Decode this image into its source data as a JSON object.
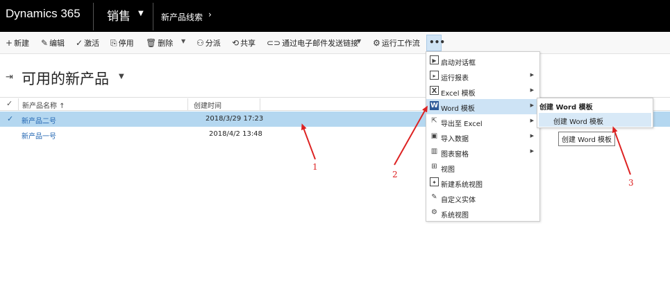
{
  "topnav": {
    "brand": "Dynamics 365",
    "area": "销售",
    "breadcrumb": "新产品线索"
  },
  "commands": [
    {
      "label": "新建",
      "icon": "plus-icon"
    },
    {
      "label": "编辑",
      "icon": "pencil-icon"
    },
    {
      "label": "激活",
      "icon": "check-icon"
    },
    {
      "label": "停用",
      "icon": "deactivate-icon"
    },
    {
      "label": "删除",
      "icon": "trash-icon"
    },
    {
      "label": "分派",
      "icon": "assign-icon"
    },
    {
      "label": "共享",
      "icon": "share-icon"
    },
    {
      "label": "通过电子邮件发送链接",
      "icon": "link-icon"
    },
    {
      "label": "运行工作流",
      "icon": "workflow-icon"
    }
  ],
  "more_button": "•••",
  "view": {
    "title": "可用的新产品"
  },
  "grid": {
    "columns": [
      "新产品名称 ↑",
      "创建时间"
    ],
    "rows": [
      {
        "name": "新产品二号",
        "created": "2018/3/29 17:23",
        "selected": true
      },
      {
        "name": "新产品一号",
        "created": "2018/4/2 13:48",
        "selected": false
      }
    ]
  },
  "menu": {
    "items": [
      {
        "label": "启动对话框",
        "icon": "dialog-icon",
        "submenu": false
      },
      {
        "label": "运行报表",
        "icon": "report-icon",
        "submenu": true
      },
      {
        "label": "Excel 模板",
        "icon": "excel-icon",
        "submenu": true
      },
      {
        "label": "Word 模板",
        "icon": "word-icon",
        "submenu": true,
        "highlighted": true
      },
      {
        "label": "导出至 Excel",
        "icon": "export-excel-icon",
        "submenu": true
      },
      {
        "label": "导入数据",
        "icon": "import-icon",
        "submenu": true
      },
      {
        "label": "图表窗格",
        "icon": "chart-icon",
        "submenu": true
      },
      {
        "label": "视图",
        "icon": "view-icon",
        "submenu": false
      },
      {
        "label": "新建系统视图",
        "icon": "new-view-icon",
        "submenu": false
      },
      {
        "label": "自定义实体",
        "icon": "customize-icon",
        "submenu": false
      },
      {
        "label": "系统视图",
        "icon": "gear-icon",
        "submenu": false
      }
    ]
  },
  "submenu": {
    "heading": "创建 Word 模板",
    "item": "创建 Word 模板"
  },
  "tooltip": "创建 Word 模板",
  "annotations": [
    "1",
    "2",
    "3"
  ],
  "colors": {
    "nav_bg": "#000000",
    "selected_row": "#b4d7f0",
    "link": "#2165b2",
    "annotation": "#dd2222"
  }
}
